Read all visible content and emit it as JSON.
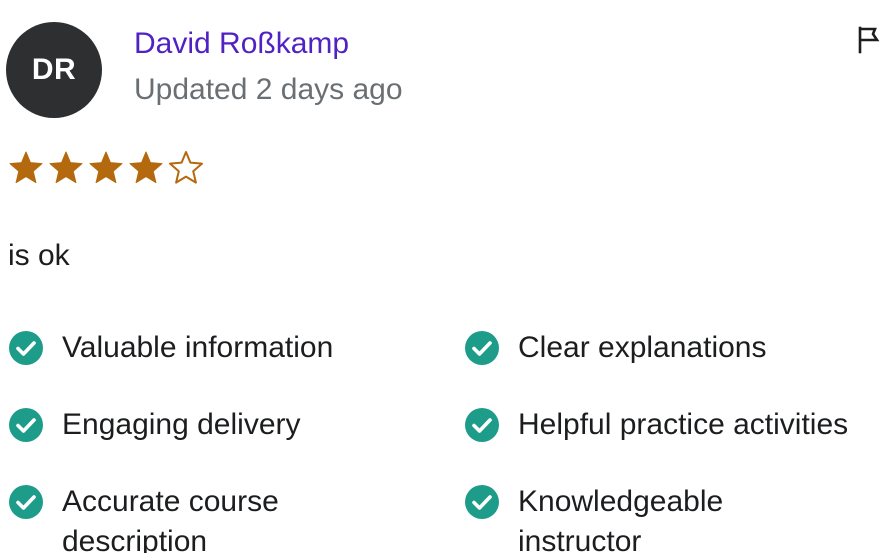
{
  "reviewer": {
    "initials": "DR",
    "name": "David Roßkamp",
    "updated": "Updated 2 days ago"
  },
  "rating": {
    "value": 4,
    "max": 5,
    "star_color": "#b4690e"
  },
  "review": {
    "comment": "is ok"
  },
  "tags": [
    {
      "label": "Valuable information",
      "icon": "check-circle-icon"
    },
    {
      "label": "Clear explanations",
      "icon": "check-circle-icon"
    },
    {
      "label": "Engaging delivery",
      "icon": "check-circle-icon"
    },
    {
      "label": "Helpful practice activities",
      "icon": "check-circle-icon"
    },
    {
      "label": "Accurate course description",
      "icon": "check-circle-icon"
    },
    {
      "label": "Knowledgeable instructor",
      "icon": "check-circle-icon"
    }
  ],
  "colors": {
    "name_link": "#5022c3",
    "muted_text": "#6a6f73",
    "check_green": "#1e9c8a",
    "avatar_bg": "#2d2f31"
  },
  "icons": {
    "report": "flag-icon"
  }
}
